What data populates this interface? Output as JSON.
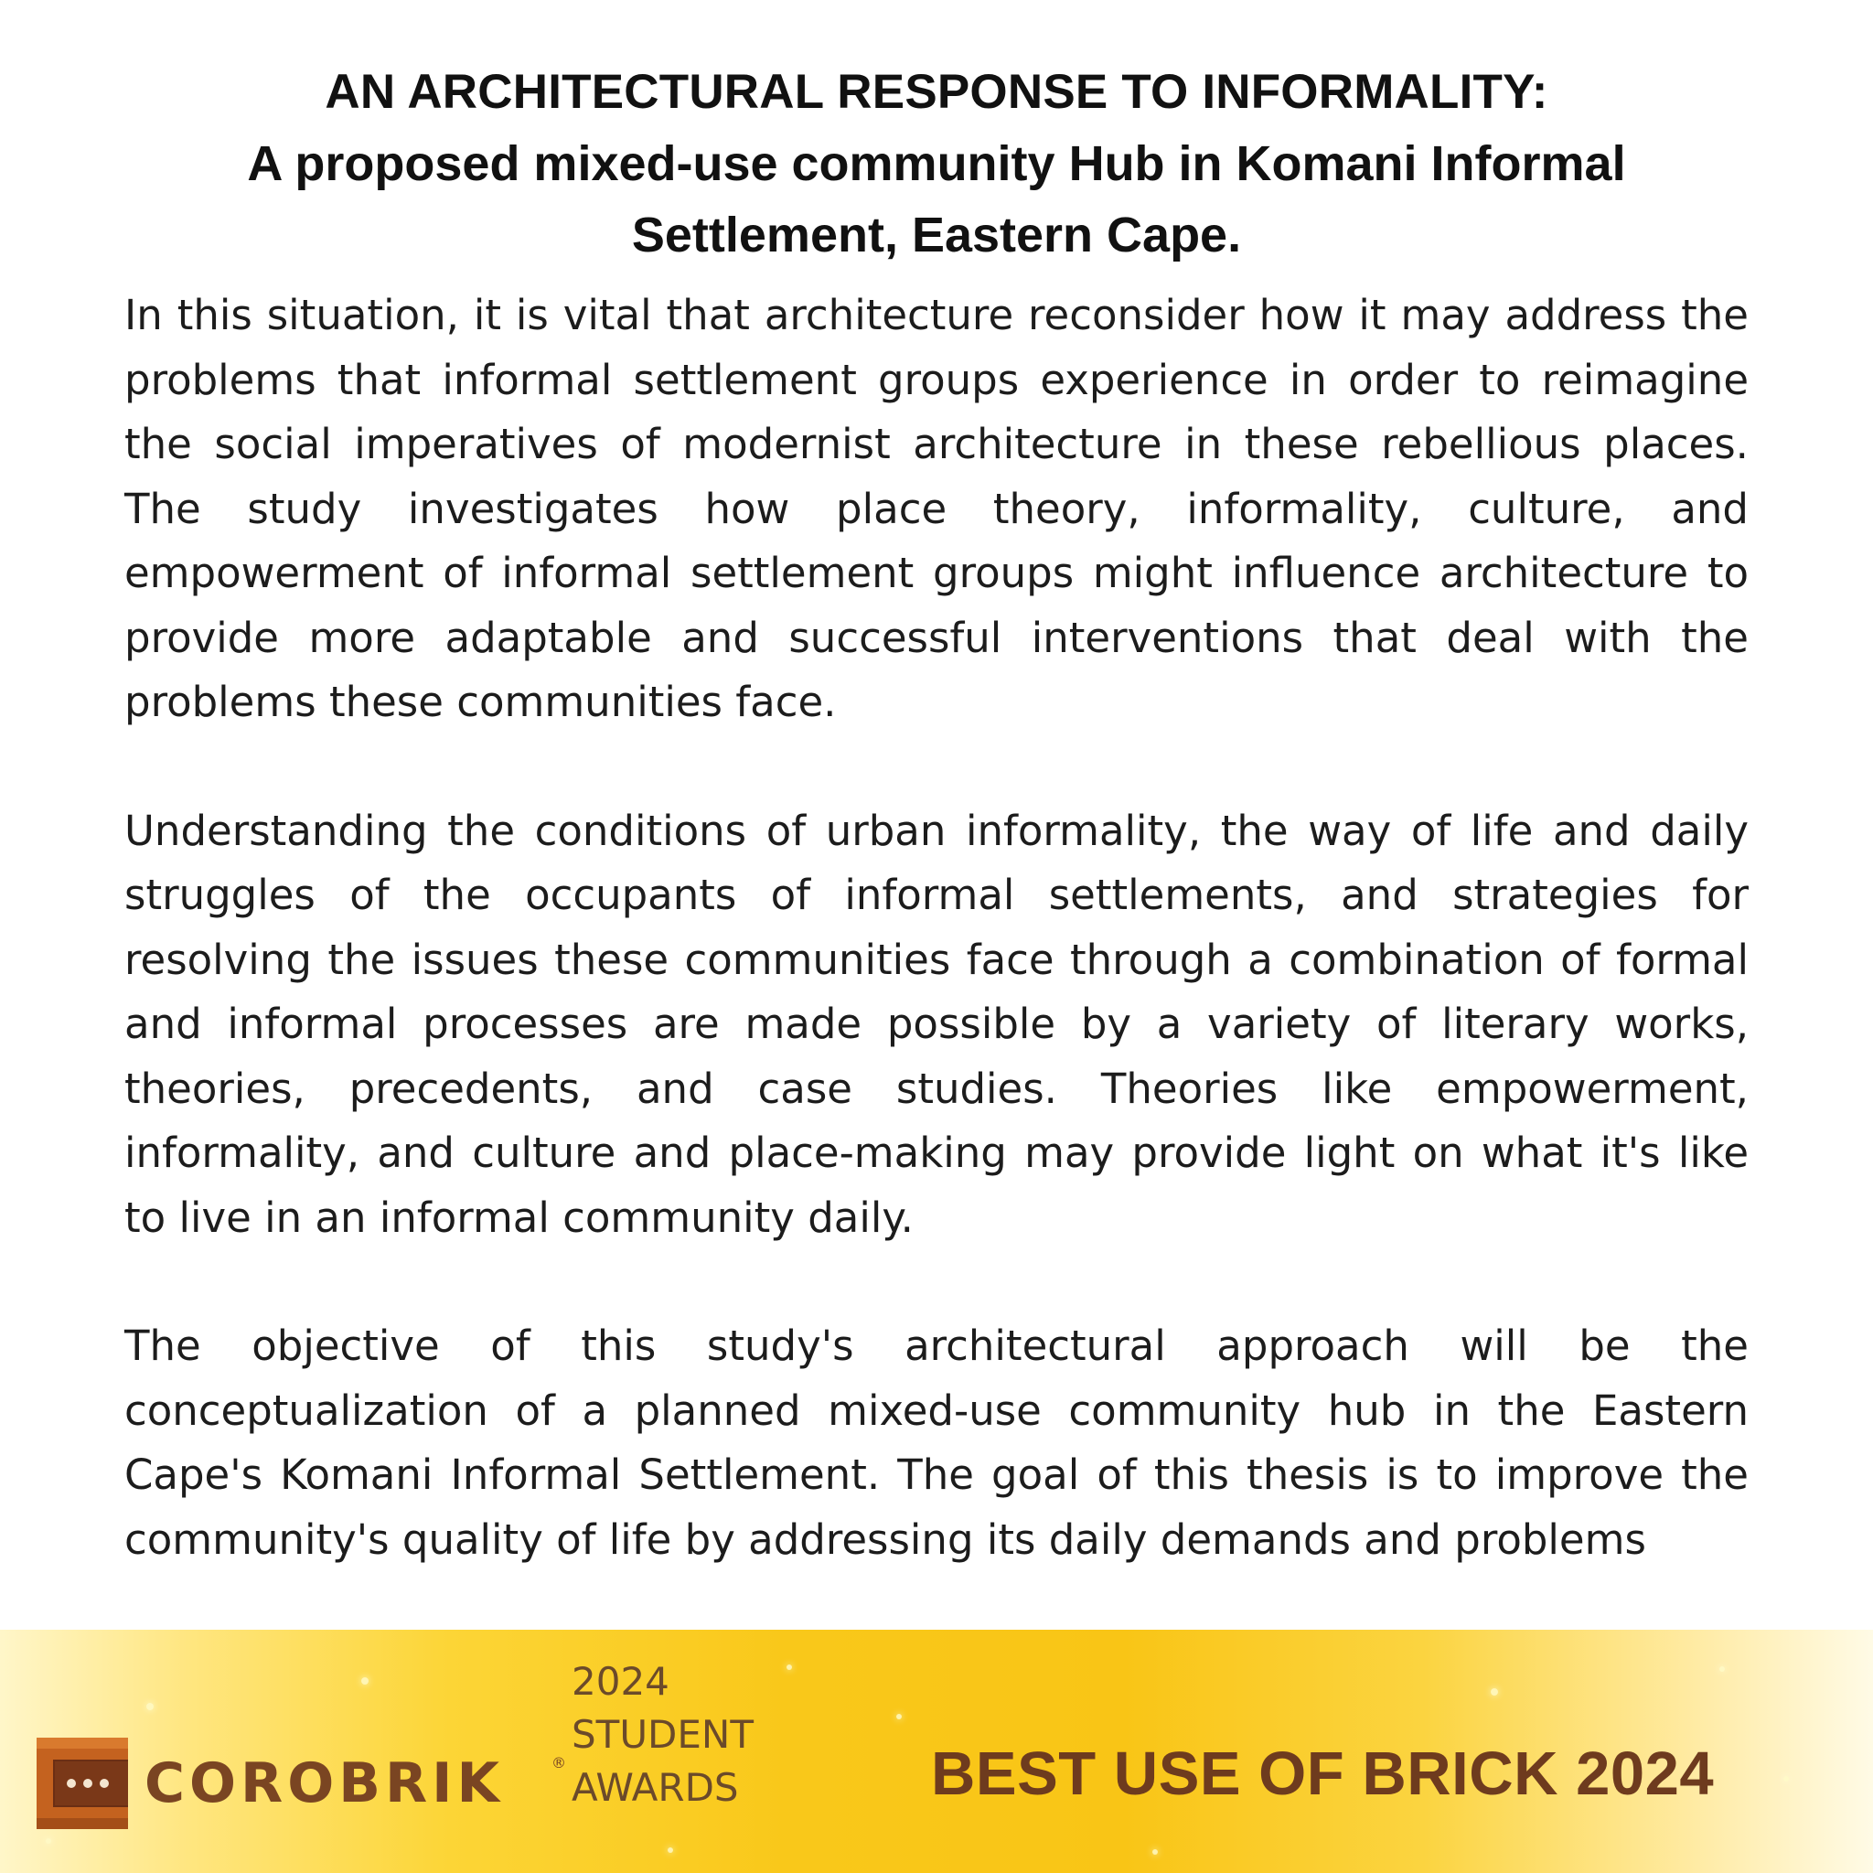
{
  "document": {
    "title_line1": "AN ARCHITECTURAL RESPONSE TO INFORMALITY:",
    "title_line2": "A proposed mixed-use community Hub in Komani Informal Settlement, Eastern Cape.",
    "paragraphs": [
      "In this situation, it is vital that architecture reconsider how it may address the problems that informal settlement groups experience in order to reimagine the social imperatives of modernist architecture in these rebellious places. The study investigates how place theory, informality, culture, and empowerment of informal settlement groups might influence architecture to provide more adaptable and successful interventions that deal with the problems these communities face.",
      "Understanding the conditions of urban informality, the way of life and daily struggles of the occupants of informal settlements, and strategies for resolving the issues these communities face through a combination of formal and informal processes are made possible by a variety of literary works, theories, precedents, and case studies. Theories like empowerment, informality, and culture and place-making may provide light on what it's like to live in an informal community daily.",
      "The objective of this study's architectural approach will be the conceptualization of a planned mixed-use community hub in the Eastern Cape's Komani Informal Settlement. The goal of this thesis is to improve the community's quality of life by addressing its daily demands and problems"
    ]
  },
  "banner": {
    "brand": "COROBRIK",
    "registered_mark": "®",
    "awards_year": "2024",
    "awards_line2": "STUDENT",
    "awards_line3": "AWARDS",
    "award_title": "BEST USE OF BRICK 2024",
    "logo_icon": "corobrik-brick-logo-icon",
    "colors": {
      "banner_gold": "#f9c516",
      "brand_brown": "#7a4522",
      "award_text": "#6e3b1e",
      "logo_orange": "#c4621f"
    }
  }
}
